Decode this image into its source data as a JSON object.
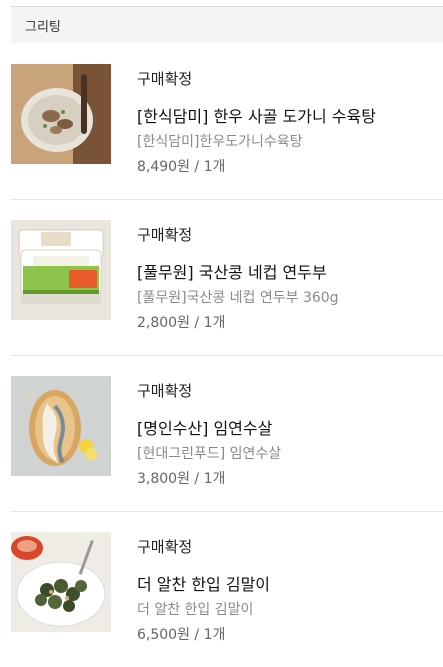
{
  "section": {
    "title": "그리팅"
  },
  "orders": [
    {
      "status": "구매확정",
      "title": "[한식담미] 한우 사골 도가니 수육탕",
      "subtitle": "[한식담미]한우도가니수육탕",
      "price_line": "8,490원 / 1개",
      "image_icon": "beef-soup-bowl-icon"
    },
    {
      "status": "구매확정",
      "title": "[풀무원] 국산콩 네컵 연두부",
      "subtitle": "[풀무원]국산콩 네컵 연두부 360g",
      "price_line": "2,800원 / 1개",
      "image_icon": "tofu-pack-icon",
      "package_text": [
        "풀무원",
        "국산콩",
        "네컵 연두부"
      ]
    },
    {
      "status": "구매확정",
      "title": "[명인수산] 임연수살",
      "subtitle": "[현대그린푸드] 임연수살",
      "price_line": "3,800원 / 1개",
      "image_icon": "fish-fillet-plate-icon"
    },
    {
      "status": "구매확정",
      "title": "더 알찬 한입 김말이",
      "subtitle": "더 알찬 한입 김말이",
      "price_line": "6,500원 / 1개",
      "image_icon": "gimmari-plate-icon"
    }
  ]
}
